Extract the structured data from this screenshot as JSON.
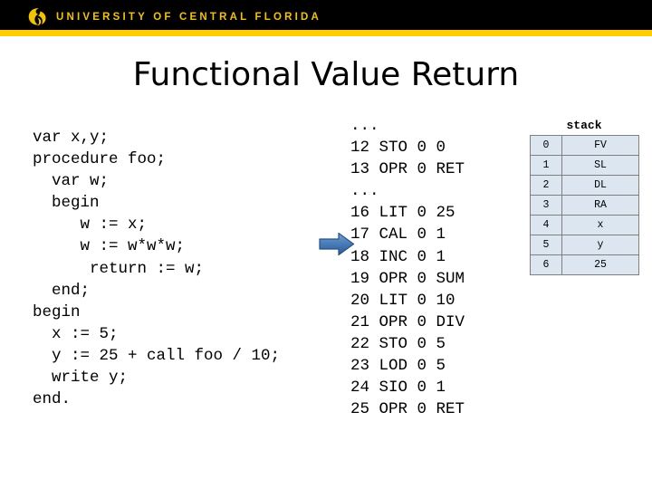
{
  "header": {
    "wordmark": "UNIVERSITY OF CENTRAL FLORIDA",
    "logo_icon": "ucf-pegasus-logo-icon",
    "bar_color": "#000000",
    "accent_color": "#ffcc00",
    "wordmark_color": "#f2c300"
  },
  "title": "Functional Value Return",
  "source_code": {
    "lines": [
      "var x,y;",
      "procedure foo;",
      "  var w;",
      "  begin",
      "     w := x;",
      "     w := w*w*w;",
      "      return := w;",
      "  end;",
      "begin",
      "  x := 5;",
      "  y := 25 + call foo / 10;",
      "  write y;",
      "end."
    ]
  },
  "assembly_code": {
    "lines": [
      "...",
      "12 STO 0 0",
      "13 OPR 0 RET",
      "...",
      "16 LIT 0 25",
      "17 CAL 0 1",
      "18 INC 0 1",
      "19 OPR 0 SUM",
      "20 LIT 0 10",
      "21 OPR 0 DIV",
      "22 STO 0 5",
      "23 LOD 0 5",
      "24 SIO 0 1",
      "25 OPR 0 RET"
    ]
  },
  "pointer": {
    "icon": "right-arrow-icon",
    "points_to_line": "17 CAL 0 1",
    "color": "#4a7ebb"
  },
  "stack": {
    "label": "stack",
    "cell_color": "#dce6f1",
    "border_color": "#808080",
    "rows": [
      {
        "index": "0",
        "value": "FV"
      },
      {
        "index": "1",
        "value": "SL"
      },
      {
        "index": "2",
        "value": "DL"
      },
      {
        "index": "3",
        "value": "RA"
      },
      {
        "index": "4",
        "value": "x"
      },
      {
        "index": "5",
        "value": "y"
      },
      {
        "index": "6",
        "value": "25"
      }
    ]
  }
}
